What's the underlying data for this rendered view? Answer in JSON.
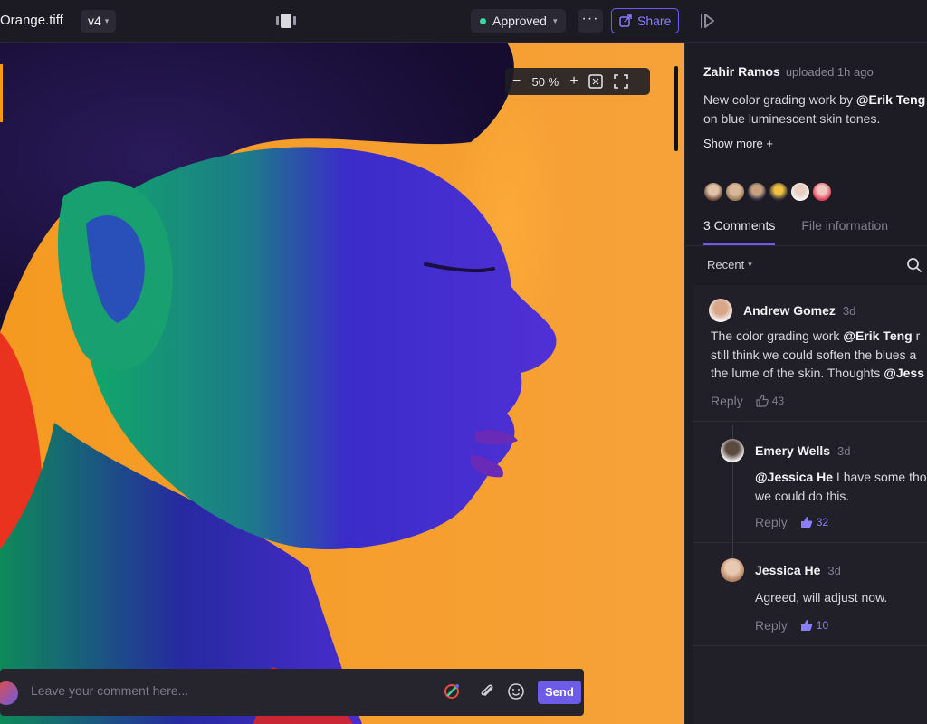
{
  "header": {
    "filename": "Orange.tiff",
    "version": "v4",
    "status": "Approved",
    "more_label": "···",
    "share_label": "Share"
  },
  "viewer": {
    "zoom_level": "50 %",
    "comment_placeholder": "Leave your comment here...",
    "send_label": "Send"
  },
  "panel": {
    "uploader_name": "Zahir Ramos",
    "uploader_meta": "uploaded 1h ago",
    "description_prefix": "New color grading work by ",
    "description_mention": "@Erik Teng",
    "description_suffix": "on blue luminescent skin tones.",
    "show_more": "Show more +",
    "tabs": [
      {
        "label": "3 Comments"
      },
      {
        "label": "File information"
      }
    ],
    "sort_label": "Recent",
    "comments": [
      {
        "author": "Andrew Gomez",
        "time": "3d",
        "text_1": "The color grading work ",
        "mention_1": "@Erik Teng",
        "text_2": " r",
        "text_3": "still think we could soften the blues a",
        "text_4": "the lume of the skin. Thoughts ",
        "mention_2": "@Jess",
        "reply_label": "Reply",
        "likes": "43"
      },
      {
        "author": "Emery Wells",
        "time": "3d",
        "mention": "@Jessica He",
        "text_1": " I have some tho",
        "text_2": "we could do this.",
        "reply_label": "Reply",
        "likes": "32"
      },
      {
        "author": "Jessica He",
        "time": "3d",
        "text_1": "Agreed, will adjust now.",
        "reply_label": "Reply",
        "likes": "10"
      }
    ]
  },
  "colors": {
    "accent": "#6c5ce7",
    "approved": "#3dd6a3",
    "background": "#1b1b22",
    "image_orange": "#f59a20"
  },
  "icons": [
    "compare-icon",
    "more-icon",
    "share-icon",
    "panel-toggle-icon",
    "zoom-out-icon",
    "zoom-in-icon",
    "fit-icon",
    "fullscreen-icon",
    "color-picker-icon",
    "attachment-icon",
    "emoji-icon",
    "search-icon",
    "thumbs-up-icon"
  ]
}
